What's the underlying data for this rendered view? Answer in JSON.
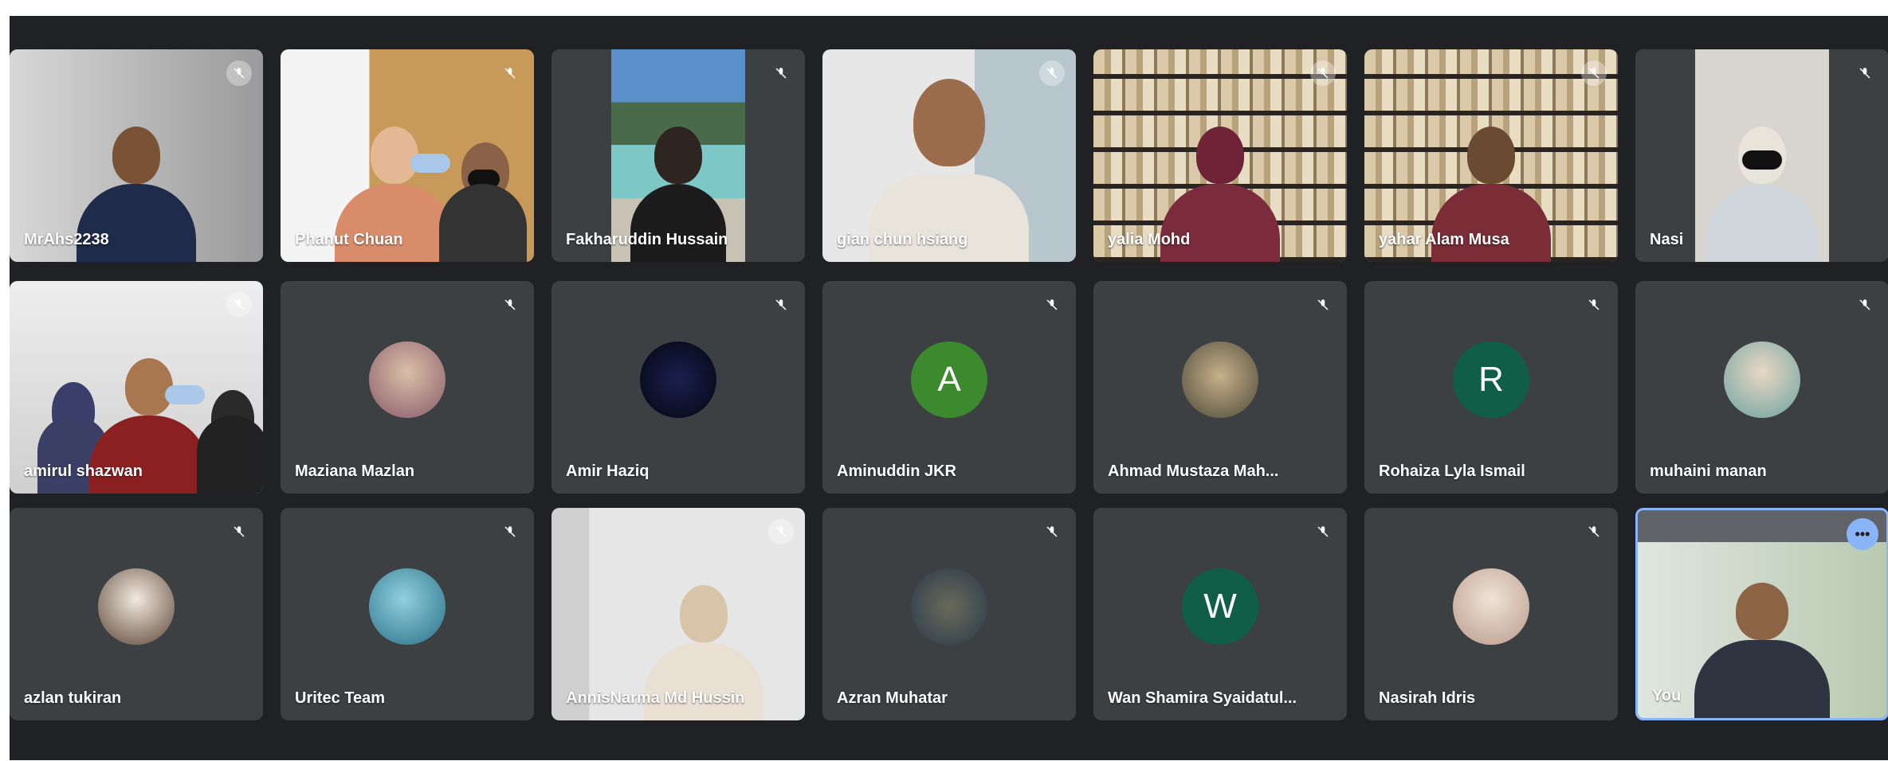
{
  "participants": [
    {
      "name": "MrAhs2238",
      "video": true
    },
    {
      "name": "Phanut Chuan",
      "video": true
    },
    {
      "name": "Fakharuddin Hussain",
      "video": true
    },
    {
      "name": "gian chun hsiang",
      "video": true
    },
    {
      "name": "yalia Mohd",
      "video": true
    },
    {
      "name": "yahar Alam Musa",
      "video": true
    },
    {
      "name": "Nasi",
      "video": true
    },
    {
      "name": "amirul shazwan",
      "video": true
    },
    {
      "name": "Maziana Mazlan",
      "video": false,
      "avatar": "photo"
    },
    {
      "name": "Amir Haziq",
      "video": false,
      "avatar": "photo"
    },
    {
      "name": "Aminuddin JKR",
      "video": false,
      "avatar_letter": "A",
      "avatar_color": "#3c8a2e"
    },
    {
      "name": "Ahmad Mustaza Mah...",
      "video": false,
      "avatar": "photo"
    },
    {
      "name": "Rohaiza Lyla Ismail",
      "video": false,
      "avatar_letter": "R",
      "avatar_color": "#0f5e45"
    },
    {
      "name": "muhaini manan",
      "video": false,
      "avatar": "photo"
    },
    {
      "name": "azlan tukiran",
      "video": false,
      "avatar": "photo"
    },
    {
      "name": "Uritec Team",
      "video": false,
      "avatar": "photo"
    },
    {
      "name": "AnnisNarma Md Hussin",
      "video": true
    },
    {
      "name": "Azran Muhatar",
      "video": false,
      "avatar": "photo"
    },
    {
      "name": "Wan Shamira Syaidatul...",
      "video": false,
      "avatar_letter": "W",
      "avatar_color": "#0f5e45"
    },
    {
      "name": "Nasirah Idris",
      "video": false,
      "avatar": "photo"
    },
    {
      "name": "You",
      "video": true,
      "self": true
    }
  ],
  "icons": {
    "mic_off": "mic-off-icon",
    "more": "more-options-icon"
  },
  "colors": {
    "background": "#202124",
    "tile": "#3c4043",
    "self_border": "#8ab4f8"
  }
}
